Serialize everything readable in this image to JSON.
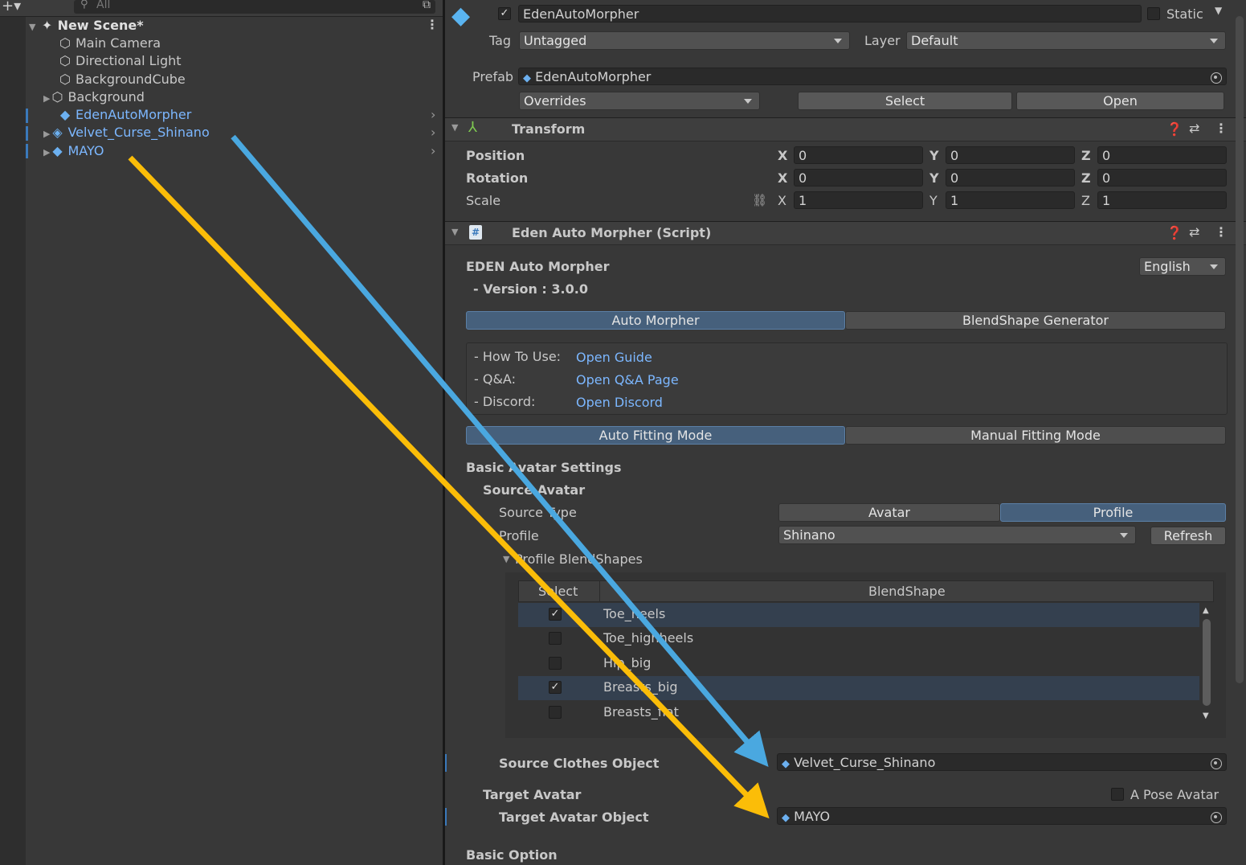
{
  "hierarchy": {
    "search_placeholder": "All",
    "scene": "New Scene*",
    "items": [
      {
        "label": "Main Camera",
        "icon": "cube-outline-icon"
      },
      {
        "label": "Directional Light",
        "icon": "cube-outline-icon"
      },
      {
        "label": "BackgroundCube",
        "icon": "cube-outline-icon"
      },
      {
        "label": "Background",
        "icon": "cube-outline-icon"
      },
      {
        "label": "EdenAutoMorpher",
        "icon": "prefab-cube-icon"
      },
      {
        "label": "Velvet_Curse_Shinano",
        "icon": "prefab-cube-icon"
      },
      {
        "label": "MAYO",
        "icon": "prefab-cube-icon"
      }
    ]
  },
  "inspector": {
    "object_name": "EdenAutoMorpher",
    "static_label": "Static",
    "tag_label": "Tag",
    "tag_value": "Untagged",
    "layer_label": "Layer",
    "layer_value": "Default",
    "prefab_label": "Prefab",
    "prefab_value": "EdenAutoMorpher",
    "overrides": "Overrides",
    "select": "Select",
    "open": "Open",
    "transform": {
      "title": "Transform",
      "position": "Position",
      "rotation": "Rotation",
      "scale": "Scale",
      "x": "X",
      "y": "Y",
      "z": "Z",
      "pos": [
        "0",
        "0",
        "0"
      ],
      "rot": [
        "0",
        "0",
        "0"
      ],
      "scl": [
        "1",
        "1",
        "1"
      ]
    },
    "script": {
      "title": "Eden Auto Morpher (Script)",
      "name": "EDEN Auto Morpher",
      "version": "- Version : 3.0.0",
      "language": "English",
      "tab_auto": "Auto Morpher",
      "tab_blend": "BlendShape Generator",
      "howto_label": "- How To Use:",
      "howto_link": "Open Guide",
      "qa_label": "- Q&A:",
      "qa_link": "Open Q&A Page",
      "discord_label": "- Discord:",
      "discord_link": "Open Discord",
      "mode_auto": "Auto Fitting Mode",
      "mode_manual": "Manual Fitting Mode",
      "basic_avatar": "Basic Avatar Settings",
      "source_avatar": "Source Avatar",
      "source_type": "Source Type",
      "type_avatar": "Avatar",
      "type_profile": "Profile",
      "profile_label": "Profile",
      "profile_value": "Shinano",
      "refresh": "Refresh",
      "profile_blendshapes": "Profile BlendShapes",
      "col_select": "Select",
      "col_blend": "BlendShape",
      "rows": [
        {
          "name": "Toe_heels",
          "checked": true
        },
        {
          "name": "Toe_highheels",
          "checked": false
        },
        {
          "name": "Hip_big",
          "checked": false
        },
        {
          "name": "Breasts_big",
          "checked": true
        },
        {
          "name": "Breasts_flat",
          "checked": false
        }
      ],
      "source_clothes_label": "Source Clothes Object",
      "source_clothes_value": "Velvet_Curse_Shinano",
      "target_avatar": "Target Avatar",
      "apose": "A Pose Avatar",
      "target_obj_label": "Target Avatar Object",
      "target_obj_value": "MAYO",
      "basic_option": "Basic Option"
    }
  },
  "colors": {
    "arrow_blue": "#4aa8e0",
    "arrow_yellow": "#fbbd08",
    "accent": "#46607c"
  }
}
